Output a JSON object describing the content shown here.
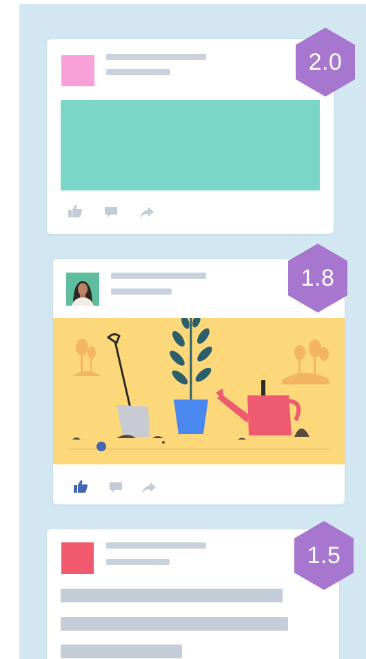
{
  "feed": {
    "posts": [
      {
        "score": "2.0",
        "avatar_color": "#f7a1d8",
        "media_color": "#7ad6c6",
        "liked": false
      },
      {
        "score": "1.8",
        "avatar": "person-photo",
        "media": "garden-tools-illustration",
        "liked": true
      },
      {
        "score": "1.5",
        "avatar_color": "#f0596e",
        "media": "text-lines",
        "liked": false
      }
    ]
  },
  "colors": {
    "background": "#d3e7f2",
    "card": "#ffffff",
    "badge": "#a777cf",
    "placeholder_line": "#c9d2dc",
    "icon_inactive": "#c3ccd6",
    "icon_liked": "#4267b2",
    "illustration_bg": "#fcd87a"
  },
  "icons": {
    "like": "thumbs-up-icon",
    "comment": "comment-icon",
    "share": "share-icon"
  }
}
